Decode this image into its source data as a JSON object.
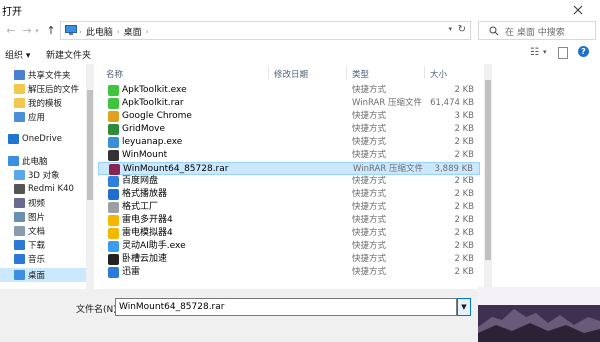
{
  "window": {
    "title": "打开"
  },
  "address": {
    "crumbs": [
      "此电脑",
      "桌面"
    ],
    "search_placeholder": "在 桌面 中搜索"
  },
  "toolbar": {
    "organize_label": "组织 ▾",
    "new_folder_label": "新建文件夹"
  },
  "nav": {
    "items": [
      {
        "label": "共享文件夹",
        "icon": "share-folder-icon",
        "color": "#4a7fd1"
      },
      {
        "label": "解压后的文件",
        "icon": "folder-icon",
        "color": "#f2c94c"
      },
      {
        "label": "我的模板",
        "icon": "folder-icon",
        "color": "#f2c94c"
      },
      {
        "label": "应用",
        "icon": "folder-icon",
        "color": "#4a90d9"
      },
      {
        "label": "OneDrive",
        "icon": "cloud-icon",
        "color": "#1e76d2"
      },
      {
        "label": "此电脑",
        "icon": "pc-icon",
        "color": "#3b8ee0"
      },
      {
        "label": "3D 对象",
        "icon": "cube-icon",
        "color": "#5aa9e6"
      },
      {
        "label": "Redmi K40",
        "icon": "phone-icon",
        "color": "#555555"
      },
      {
        "label": "视频",
        "icon": "video-icon",
        "color": "#6b6b8f"
      },
      {
        "label": "图片",
        "icon": "picture-icon",
        "color": "#6b8fb0"
      },
      {
        "label": "文档",
        "icon": "document-icon",
        "color": "#8a9bb0"
      },
      {
        "label": "下载",
        "icon": "download-icon",
        "color": "#2b78d6"
      },
      {
        "label": "音乐",
        "icon": "music-icon",
        "color": "#2b78d6"
      },
      {
        "label": "桌面",
        "icon": "desktop-icon",
        "color": "#3b8ee0"
      }
    ]
  },
  "columns": {
    "name": "名称",
    "modified": "修改日期",
    "type": "类型",
    "size": "大小"
  },
  "files": [
    {
      "name": "ApkToolkit.exe",
      "type": "快捷方式",
      "size": "2 KB",
      "icon": "green-android-icon",
      "color": "#3ec43e"
    },
    {
      "name": "ApkToolkit.rar",
      "type": "WinRAR 压缩文件",
      "size": "61,474 KB",
      "icon": "green-android-icon",
      "color": "#3ec43e"
    },
    {
      "name": "Google Chrome",
      "type": "快捷方式",
      "size": "3 KB",
      "icon": "chrome-icon",
      "color": "#e0a020"
    },
    {
      "name": "GridMove",
      "type": "快捷方式",
      "size": "2 KB",
      "icon": "grid-icon",
      "color": "#2e8b3c"
    },
    {
      "name": "leyuanap.exe",
      "type": "快捷方式",
      "size": "2 KB",
      "icon": "globe-icon",
      "color": "#3a8fd6"
    },
    {
      "name": "WinMount",
      "type": "快捷方式",
      "size": "2 KB",
      "icon": "disc-icon",
      "color": "#333333"
    },
    {
      "name": "WinMount64_85728.rar",
      "type": "WinRAR 压缩文件",
      "size": "3,889 KB",
      "icon": "rar-icon",
      "color": "#8b2252"
    },
    {
      "name": "百度网盘",
      "type": "快捷方式",
      "size": "2 KB",
      "icon": "cloud-icon",
      "color": "#2f7fe0"
    },
    {
      "name": "格式播放器",
      "type": "快捷方式",
      "size": "2 KB",
      "icon": "player-icon",
      "color": "#1f6fd0"
    },
    {
      "name": "格式工厂",
      "type": "快捷方式",
      "size": "2 KB",
      "icon": "factory-icon",
      "color": "#9aa0a6"
    },
    {
      "name": "雷电多开器4",
      "type": "快捷方式",
      "size": "2 KB",
      "icon": "lightning-icon",
      "color": "#f5b800"
    },
    {
      "name": "雷电模拟器4",
      "type": "快捷方式",
      "size": "2 KB",
      "icon": "lightning-icon",
      "color": "#f5b800"
    },
    {
      "name": "灵动AI助手.exe",
      "type": "快捷方式",
      "size": "2 KB",
      "icon": "ai-icon",
      "color": "#3a9bf0"
    },
    {
      "name": "卧槽云加速",
      "type": "快捷方式",
      "size": "2 KB",
      "icon": "rocket-icon",
      "color": "#222222"
    },
    {
      "name": "迅雷",
      "type": "快捷方式",
      "size": "2 KB",
      "icon": "thunder-icon",
      "color": "#2a7bd8"
    }
  ],
  "selected_file": "WinMount64_85728.rar",
  "bottom": {
    "filename_label": "文件名(N):",
    "filename_value": "WinMount64_85728.rar"
  }
}
